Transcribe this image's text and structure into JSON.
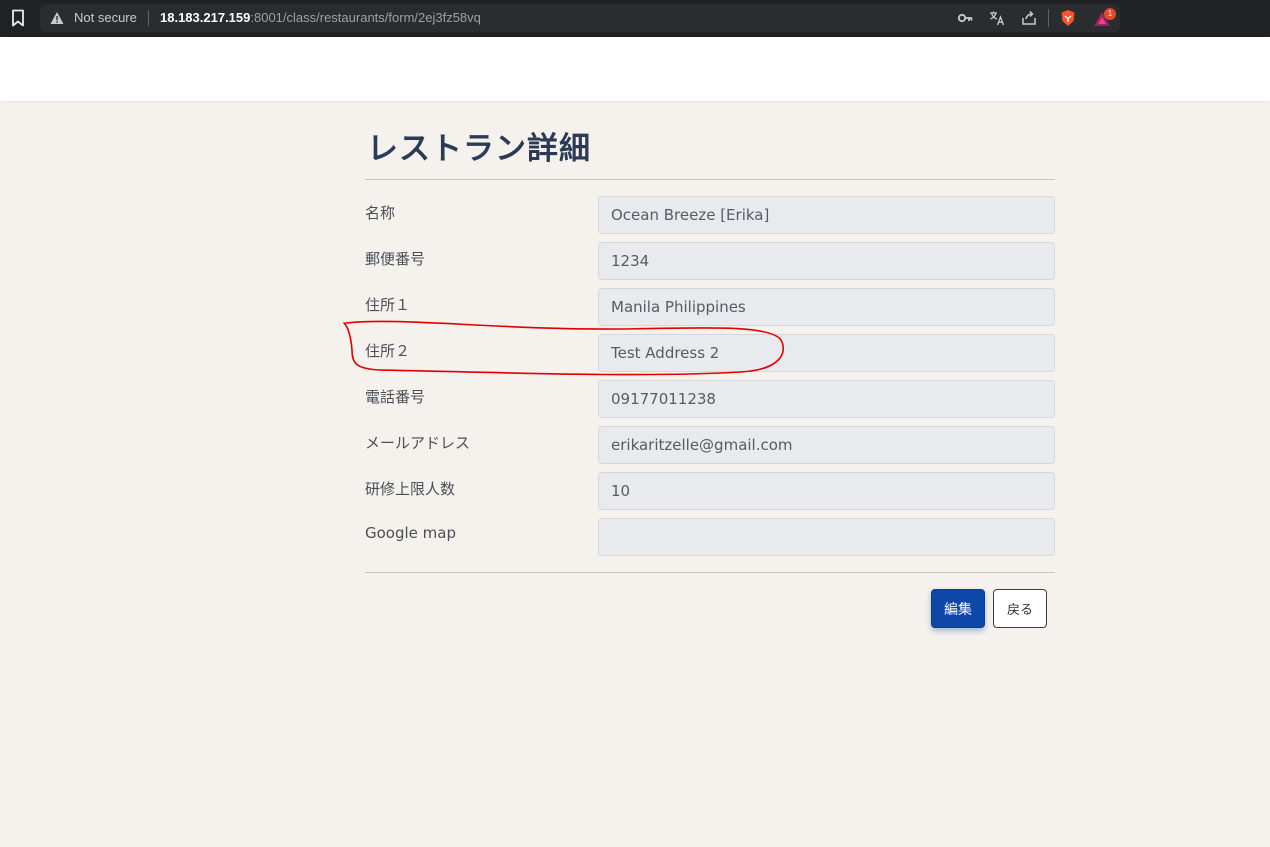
{
  "browser": {
    "security_label": "Not secure",
    "url_host": "18.183.217.159",
    "url_rest": ":8001/class/restaurants/form/2ej3fz58vq",
    "extension_badge": "1"
  },
  "page": {
    "title": "レストラン詳細"
  },
  "fields": [
    {
      "label": "名称",
      "value": "Ocean Breeze [Erika]"
    },
    {
      "label": "郵便番号",
      "value": "1234"
    },
    {
      "label": "住所１",
      "value": "Manila Philippines"
    },
    {
      "label": "住所２",
      "value": "Test Address 2"
    },
    {
      "label": "電話番号",
      "value": "09177011238"
    },
    {
      "label": "メールアドレス",
      "value": "erikaritzelle@gmail.com"
    },
    {
      "label": "研修上限人数",
      "value": "10"
    },
    {
      "label": "Google map",
      "value": ""
    }
  ],
  "actions": {
    "edit_label": "編集",
    "back_label": "戻る"
  },
  "colors": {
    "accent": "#0d47a8",
    "title": "#2c3b55",
    "background": "#f5f2ee",
    "annotation": "#e00000"
  }
}
